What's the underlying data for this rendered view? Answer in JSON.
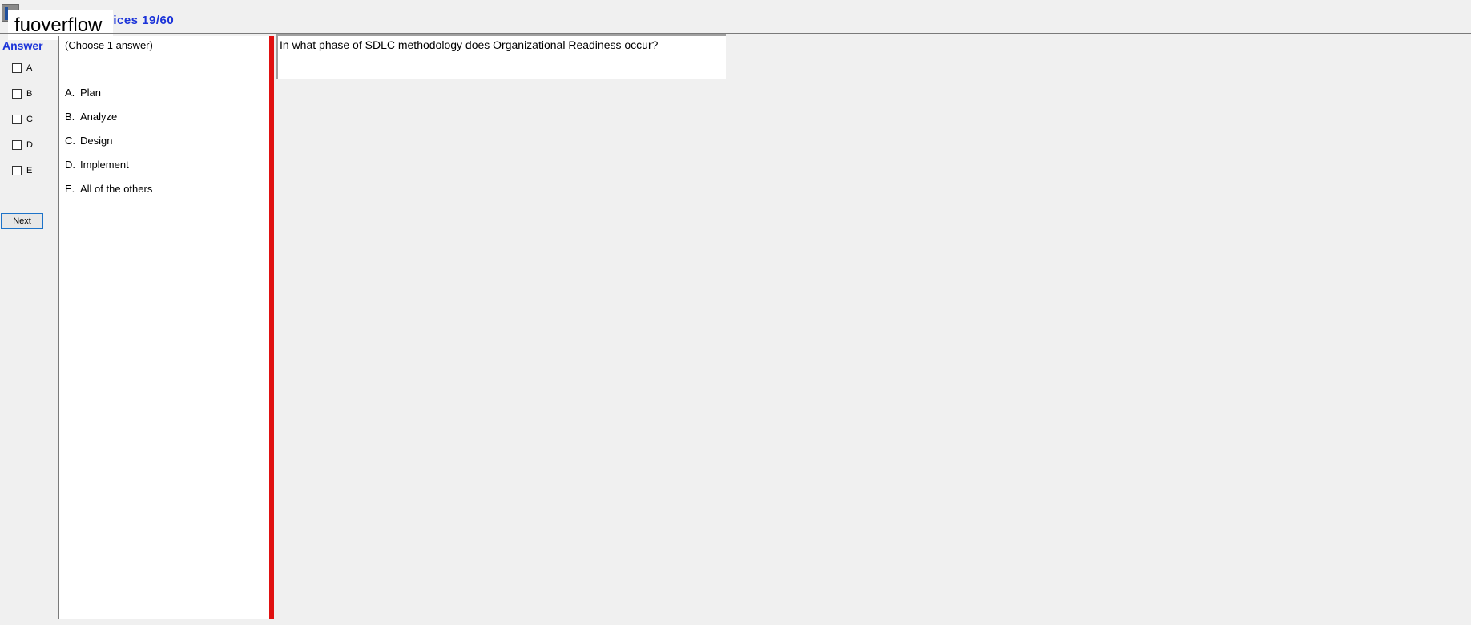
{
  "header": {
    "title": "hoices 19/60",
    "overflow_label": "fuoverflow"
  },
  "answer_panel": {
    "heading": "Answer",
    "options": [
      "A",
      "B",
      "C",
      "D",
      "E"
    ],
    "next_label": "Next"
  },
  "choices": {
    "instruction": "(Choose 1 answer)",
    "items": [
      {
        "letter": "A.",
        "text": "Plan"
      },
      {
        "letter": "B.",
        "text": "Analyze"
      },
      {
        "letter": "C.",
        "text": "Design"
      },
      {
        "letter": "D.",
        "text": "Implement"
      },
      {
        "letter": "E.",
        "text": "All of the others"
      }
    ]
  },
  "question": {
    "text": "In what phase of SDLC methodology does Organizational Readiness occur?"
  },
  "colors": {
    "accent_blue": "#1c34d9",
    "splitter_red": "#e01010",
    "background": "#f0f0f0"
  }
}
